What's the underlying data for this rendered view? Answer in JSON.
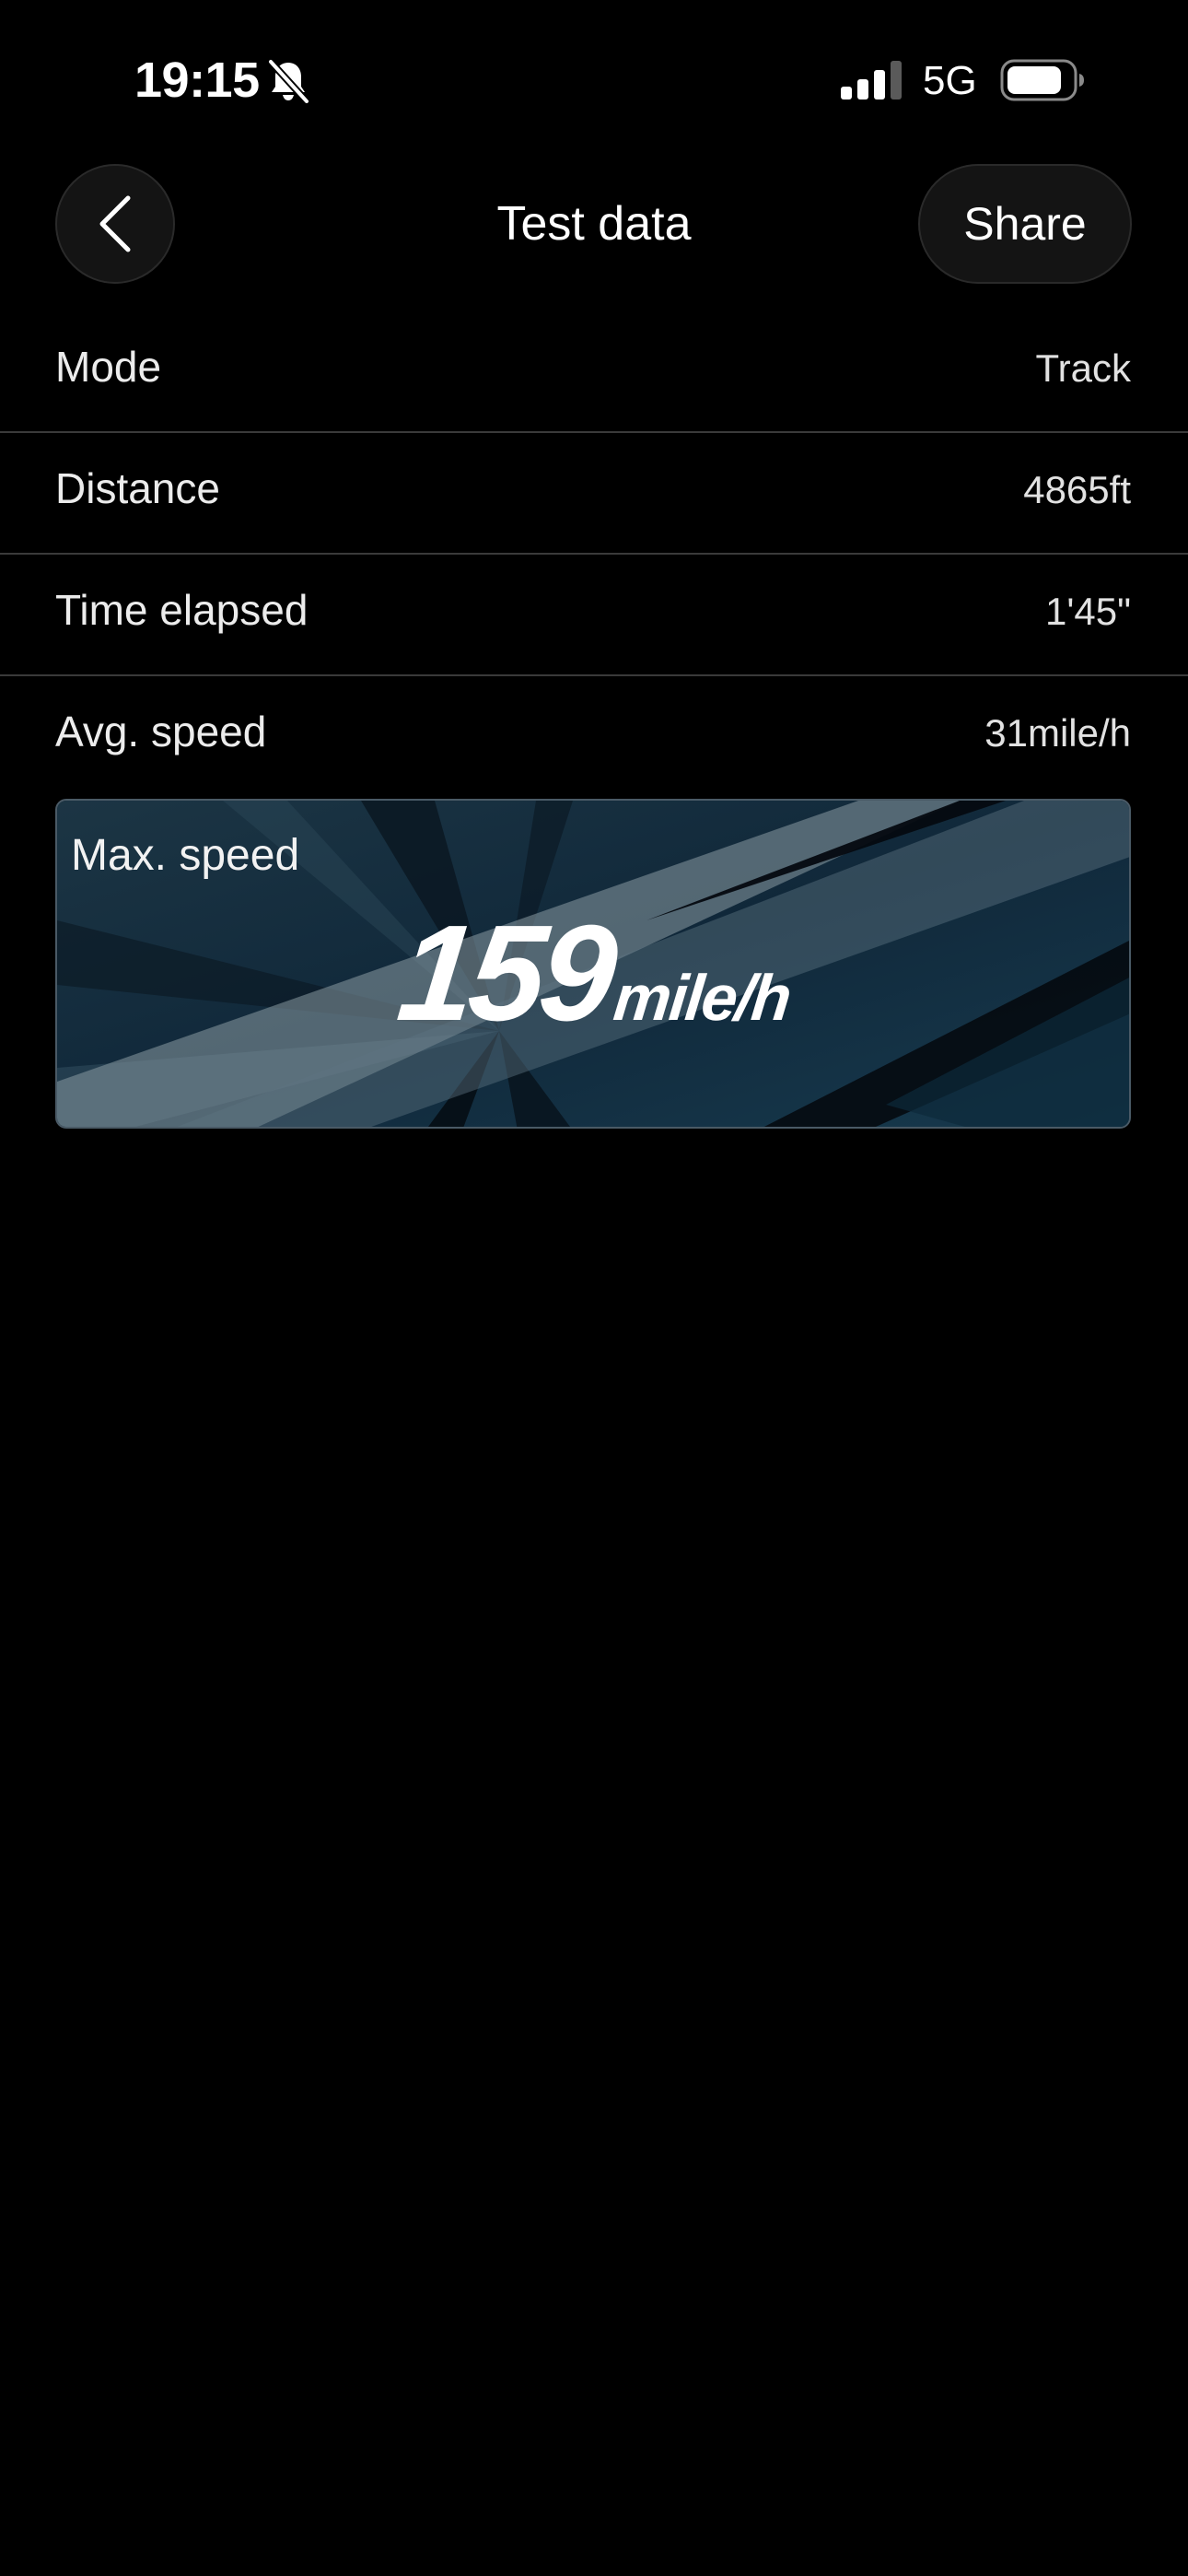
{
  "status_bar": {
    "time": "19:15",
    "network": "5G",
    "icons": [
      "bell-slash-icon",
      "signal-icon",
      "battery-icon"
    ]
  },
  "nav": {
    "back_icon": "chevron-left-icon",
    "title": "Test data",
    "share_label": "Share"
  },
  "info_rows": [
    {
      "label": "Mode",
      "value": "Track"
    },
    {
      "label": "Distance",
      "value": "4865ft"
    },
    {
      "label": "Time elapsed",
      "value": "1'45\""
    },
    {
      "label": "Avg. speed",
      "value": "31mile/h"
    }
  ],
  "max_speed": {
    "label": "Max. speed",
    "value": "159",
    "unit": "mile/h"
  },
  "colors": {
    "background": "#000000",
    "text": "#ffffff",
    "divider": "#3a3a3a",
    "button_bg": "#141414",
    "card_bg": "#0e2230"
  }
}
